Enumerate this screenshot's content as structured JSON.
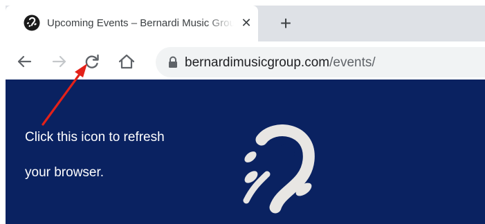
{
  "browser": {
    "tab": {
      "title": "Upcoming Events – Bernardi Music Group",
      "close_glyph": "✕",
      "favicon": "bernardi-logo-icon"
    },
    "new_tab_glyph": "+",
    "toolbar": {
      "back_icon": "back-arrow-icon",
      "forward_icon": "forward-arrow-icon",
      "reload_icon": "reload-icon",
      "home_icon": "home-icon"
    },
    "address_bar": {
      "domain": "bernardimusicgroup.com",
      "path": "/events/",
      "security_icon": "lock-icon"
    }
  },
  "page": {
    "annotation_line1": "Click this icon to refresh",
    "annotation_line2": "your browser.",
    "annotation_color": "#e32119",
    "background_color": "#0a2261",
    "logo_color": "#e8e6e3"
  }
}
